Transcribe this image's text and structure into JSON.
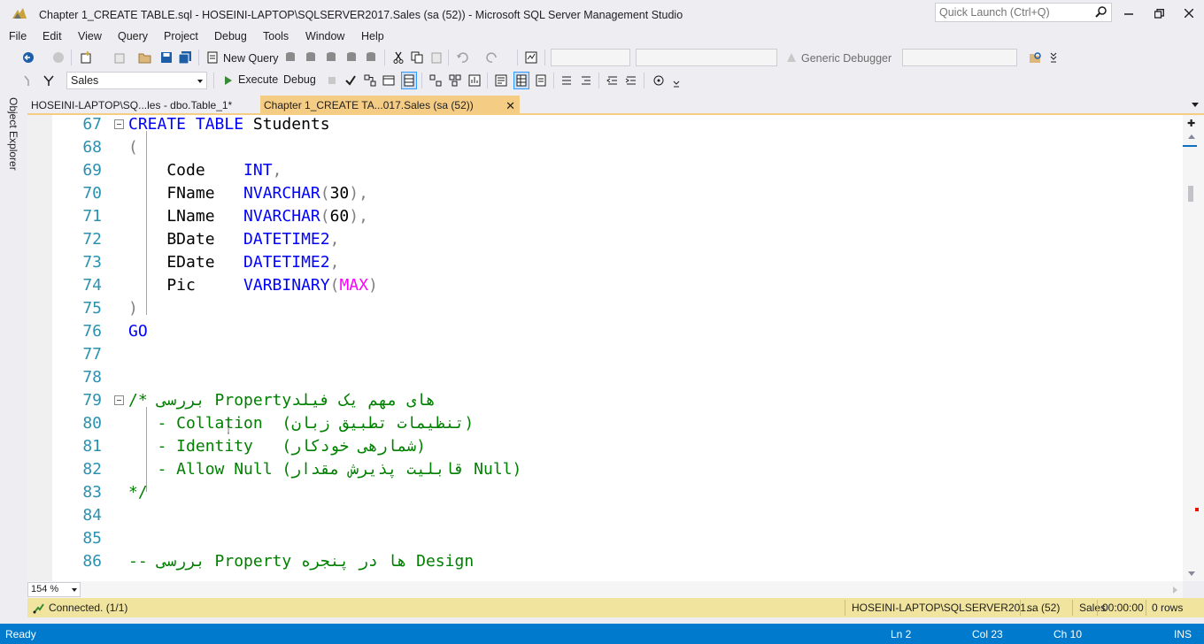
{
  "window": {
    "title": "Chapter 1_CREATE TABLE.sql - HOSEINI-LAPTOP\\SQLSERVER2017.Sales (sa (52)) - Microsoft SQL Server Management Studio",
    "quick_launch_placeholder": "Quick Launch (Ctrl+Q)"
  },
  "menu": [
    "File",
    "Edit",
    "View",
    "Query",
    "Project",
    "Debug",
    "Tools",
    "Window",
    "Help"
  ],
  "toolbar1": {
    "new_query_label": "New Query",
    "debugger_label": "Generic Debugger"
  },
  "toolbar2": {
    "database": "Sales",
    "execute_label": "Execute",
    "debug_label": "Debug"
  },
  "side_panel": {
    "object_explorer_label": "Object Explorer"
  },
  "tabs": [
    {
      "label": "HOSEINI-LAPTOP\\SQ...les - dbo.Table_1*",
      "active": false
    },
    {
      "label": "Chapter 1_CREATE TA...017.Sales (sa (52))",
      "active": true
    }
  ],
  "editor": {
    "lines": [
      {
        "n": "67",
        "segs": [
          [
            "kw",
            "CREATE TABLE"
          ],
          [
            "txt",
            " Students"
          ]
        ]
      },
      {
        "n": "68",
        "segs": [
          [
            "gray",
            "("
          ]
        ]
      },
      {
        "n": "69",
        "segs": [
          [
            "txt",
            "    Code    "
          ],
          [
            "kw",
            "INT"
          ],
          [
            "gray",
            ","
          ]
        ]
      },
      {
        "n": "70",
        "segs": [
          [
            "txt",
            "    FName   "
          ],
          [
            "kw",
            "NVARCHAR"
          ],
          [
            "gray",
            "("
          ],
          [
            "txt",
            "30"
          ],
          [
            "gray",
            "),"
          ]
        ]
      },
      {
        "n": "71",
        "segs": [
          [
            "txt",
            "    LName   "
          ],
          [
            "kw",
            "NVARCHAR"
          ],
          [
            "gray",
            "("
          ],
          [
            "txt",
            "60"
          ],
          [
            "gray",
            "),"
          ]
        ]
      },
      {
        "n": "72",
        "segs": [
          [
            "txt",
            "    BDate   "
          ],
          [
            "kw",
            "DATETIME2"
          ],
          [
            "gray",
            ","
          ]
        ]
      },
      {
        "n": "73",
        "segs": [
          [
            "txt",
            "    EDate   "
          ],
          [
            "kw",
            "DATETIME2"
          ],
          [
            "gray",
            ","
          ]
        ]
      },
      {
        "n": "74",
        "segs": [
          [
            "txt",
            "    Pic     "
          ],
          [
            "kw",
            "VARBINARY"
          ],
          [
            "gray",
            "("
          ],
          [
            "mag",
            "MAX"
          ],
          [
            "gray",
            ")"
          ]
        ]
      },
      {
        "n": "75",
        "segs": [
          [
            "gray",
            ")"
          ]
        ]
      },
      {
        "n": "76",
        "segs": [
          [
            "kw",
            "GO"
          ]
        ]
      },
      {
        "n": "77",
        "segs": []
      },
      {
        "n": "78",
        "segs": []
      },
      {
        "n": "79",
        "segs": [
          [
            "cmt",
            "/* بررسی Propertyهای مهم یک فیلد"
          ]
        ]
      },
      {
        "n": "80",
        "segs": [
          [
            "cmt",
            "   - Collation  (تنظیمات تطبیق زبان)"
          ]
        ]
      },
      {
        "n": "81",
        "segs": [
          [
            "cmt",
            "   - Identity   (شمارهی خودکار)"
          ]
        ]
      },
      {
        "n": "82",
        "segs": [
          [
            "cmt",
            "   - Allow Null (قابلیت پذیرش مقدار Null)"
          ]
        ]
      },
      {
        "n": "83",
        "segs": [
          [
            "cmt",
            "*/"
          ]
        ]
      },
      {
        "n": "84",
        "segs": []
      },
      {
        "n": "85",
        "segs": []
      },
      {
        "n": "86",
        "segs": [
          [
            "cmt",
            "-- بررسی Property ها در پنجره Design"
          ]
        ]
      }
    ]
  },
  "zoom": "154 %",
  "query_status": {
    "connection": "Connected. (1/1)",
    "server": "HOSEINI-LAPTOP\\SQLSERVER201...",
    "user": "sa (52)",
    "database": "Sales",
    "elapsed": "00:00:00",
    "rows": "0 rows"
  },
  "status_bar": {
    "state": "Ready",
    "ln": "Ln 2",
    "col": "Col 23",
    "ch": "Ch 10",
    "mode": "INS"
  },
  "colors": {
    "accent_blue": "#007acc",
    "active_tab": "#f5cc84",
    "query_status_bg": "#f0e49e",
    "keyword": "#0000ff",
    "comment": "#008000",
    "line_number": "#2b91af",
    "function_magenta": "#ff00ff"
  }
}
